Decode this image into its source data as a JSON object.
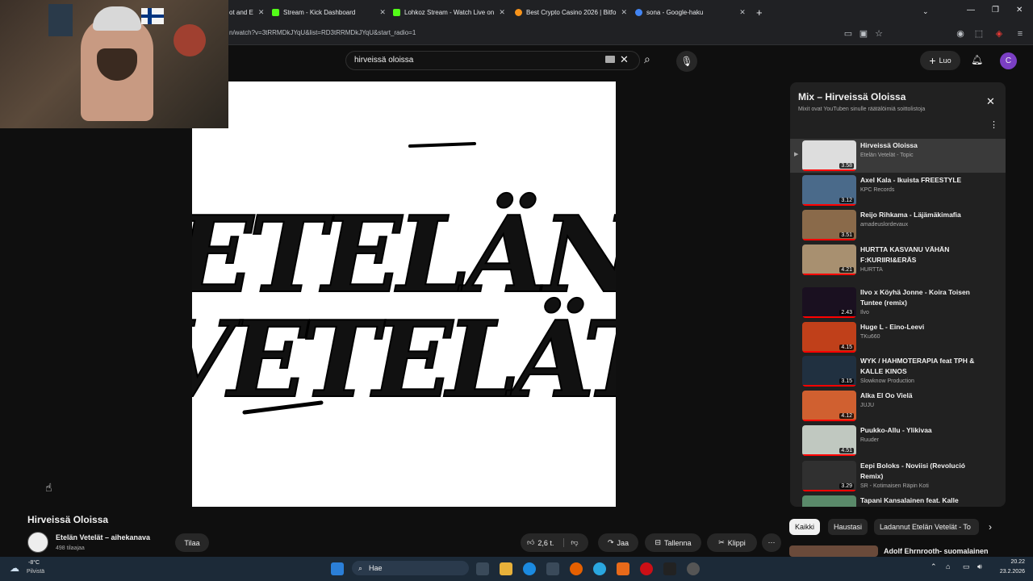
{
  "browser": {
    "tabs": [
      {
        "label": "ot and E",
        "color": "#888"
      },
      {
        "label": "Stream - Kick Dashboard",
        "color": "#53fc18"
      },
      {
        "label": "Lohkoz Stream - Watch Live on",
        "color": "#53fc18"
      },
      {
        "label": "Best Crypto Casino 2026 | Bitfo",
        "color": "#f7931a"
      },
      {
        "label": "sona - Google-haku",
        "color": "#4285f4"
      }
    ],
    "url": "n/watch?v=3tRRMDkJYqU&list=RD3tRRMDkJYqU&start_radio=1",
    "new_tab": "+"
  },
  "header": {
    "search_value": "hirveissä oloissa",
    "create_label": "Luo",
    "avatar_letter": "C"
  },
  "video": {
    "title": "Hirveissä Oloissa",
    "channel": "Etelän Vetelät – aiheкanava",
    "channel_real": "Etelän Vetelät – aihekanava",
    "subscribers": "498 tilaajaa",
    "subscribe_label": "Tilaa",
    "like_count": "2,6 t.",
    "share_label": "Jaa",
    "save_label": "Tallenna",
    "clip_label": "Klippi",
    "art_line1": "ETELÄN",
    "art_line2": "VETELÄT"
  },
  "mix": {
    "title": "Mix – Hirveissä Oloissa",
    "subtitle": "Mixit ovat YouTuben sinulle räätälöimiä soittolistoja",
    "items": [
      {
        "title": "Hirveissä Oloissa",
        "channel": "Etelän Vetelät - Topic",
        "duration": "3.58",
        "thumb": "#ddd"
      },
      {
        "title": "Axel Kala - Ikuista FREESTYLE",
        "channel": "KPC Records",
        "duration": "3.12",
        "thumb": "#4a6a8a"
      },
      {
        "title": "Reijo Rihkama - Läjämäkimafia",
        "channel": "amadeuslordevaux",
        "duration": "3.51",
        "thumb": "#8a6a4a"
      },
      {
        "title": "HURTTA KASVANU VÄHÄN F:KURIIRI&ERÄS",
        "channel": "HURTTA",
        "duration": "4.21",
        "thumb": "#a89070"
      },
      {
        "title": "Ilvo x Köyhä Jonne - Koira Toisen Tuntee (remix)",
        "channel": "Ilvo",
        "duration": "2.43",
        "thumb": "#1a1020"
      },
      {
        "title": "Huge L - Eino-Leevi",
        "channel": "TKu660",
        "duration": "4.15",
        "thumb": "#c0401a"
      },
      {
        "title": "WYK / HAHMOTERAPIA feat TPH & KALLE KINOS",
        "channel": "Slowknow Production",
        "duration": "3.15",
        "thumb": "#203040"
      },
      {
        "title": "Alka El Oo Vielä",
        "channel": "JUJU",
        "duration": "4.12",
        "thumb": "#d06030"
      },
      {
        "title": "Puukko-Allu - Ylikivaa",
        "channel": "Ruuder",
        "duration": "4.51",
        "thumb": "#c0c8c0"
      },
      {
        "title": "Eepi Boloks - Noviisi (Revolució Remix)",
        "channel": "SR - Kotimaisen Räpin Koti",
        "duration": "3.29",
        "thumb": "#303030"
      },
      {
        "title": "Tapani Kansalainen feat. Kalle",
        "channel": "",
        "duration": "",
        "thumb": "#5a8a6a"
      }
    ]
  },
  "chips": [
    "Kaikki",
    "Haustasi",
    "Ladannut Etelän Vetelät - To"
  ],
  "next_video": "Adolf Ehrnrooth- suomalainen",
  "taskbar": {
    "weather_temp": "-8°C",
    "weather_desc": "Pilvistä",
    "search_label": "Hae",
    "time": "20.22",
    "date": "23.2.2026"
  }
}
